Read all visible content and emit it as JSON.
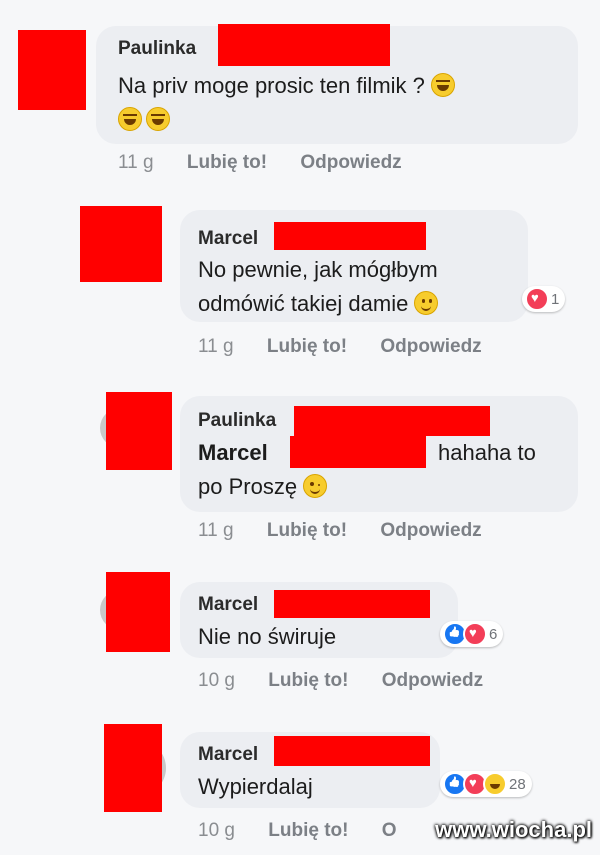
{
  "comments": [
    {
      "author": "Paulinka",
      "line1": "Na priv moge prosic ten filmik ?",
      "time": "11 g",
      "like": "Lubię to!",
      "reply": "Odpowiedz"
    },
    {
      "author": "Marcel",
      "line1": "No pewnie, jak mógłbym",
      "line2": "odmówić takiej damie",
      "reaction_count": "1",
      "time": "11 g",
      "like": "Lubię to!",
      "reply": "Odpowiedz"
    },
    {
      "author": "Paulinka",
      "mention": "Marcel",
      "line1_tail": "hahaha to",
      "line2": "po Proszę",
      "time": "11 g",
      "like": "Lubię to!",
      "reply": "Odpowiedz"
    },
    {
      "author": "Marcel",
      "line1": "Nie no świruje",
      "reaction_count": "6",
      "time": "10 g",
      "like": "Lubię to!",
      "reply": "Odpowiedz"
    },
    {
      "author": "Marcel",
      "line1": "Wypierdalaj",
      "reaction_count": "28",
      "time": "10 g",
      "like": "Lubię to!",
      "reply": "O"
    }
  ],
  "watermark": "www.wiocha.pl",
  "colors": {
    "redaction": "#ff0000",
    "bubble": "#eceef2",
    "love": "#f33e58",
    "like": "#1877f2"
  }
}
